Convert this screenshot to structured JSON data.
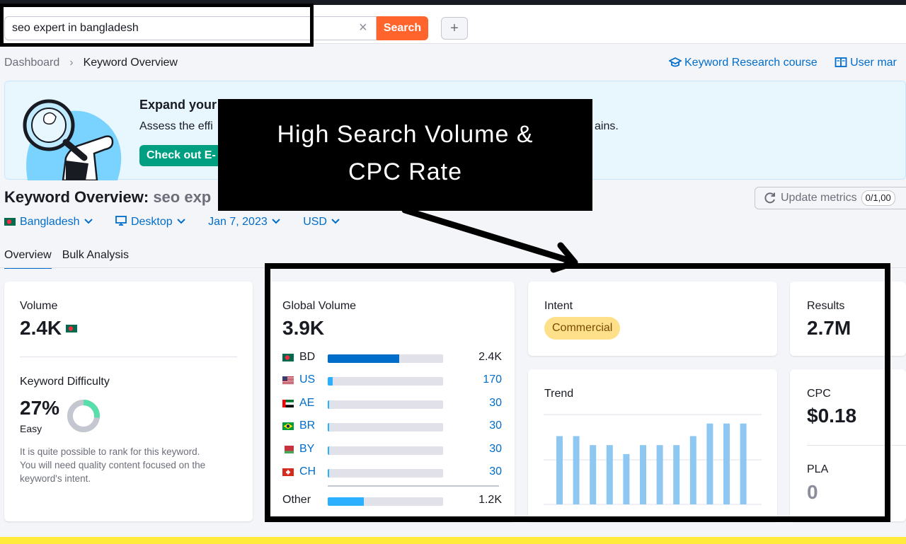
{
  "search": {
    "value": "seo expert in bangladesh",
    "button_label": "Search",
    "add_label": "+",
    "clear_label": "×"
  },
  "breadcrumb": {
    "items": [
      "Dashboard",
      "Keyword Overview"
    ]
  },
  "top_links": {
    "course": "Keyword Research course",
    "manual": "User mar"
  },
  "banner": {
    "title": "Expand your",
    "text": "Assess the effi",
    "text_tail": "ains.",
    "button": "Check out E-"
  },
  "callout": {
    "line1": "High Search Volume &",
    "line2": "CPC Rate"
  },
  "page": {
    "title_prefix": "Keyword Overview:",
    "title_keyword": "seo exp"
  },
  "update": {
    "label": "Update metrics",
    "count": "0/1,00"
  },
  "filters": {
    "country": "Bangladesh",
    "device": "Desktop",
    "date": "Jan 7, 2023",
    "currency": "USD"
  },
  "tabs": [
    "Overview",
    "Bulk Analysis"
  ],
  "volume_card": {
    "label": "Volume",
    "value": "2.4K",
    "kd_label": "Keyword Difficulty",
    "kd_value": "27%",
    "kd_level": "Easy",
    "kd_fraction": 0.27,
    "kd_desc": [
      "It is quite possible to rank for this keyword.",
      "You will need quality content focused on the",
      "keyword's intent."
    ]
  },
  "global_volume": {
    "label": "Global Volume",
    "value": "3.9K",
    "countries": [
      {
        "code": "BD",
        "value": "2.4K",
        "share": 0.62,
        "link": false,
        "color": "#006dca"
      },
      {
        "code": "US",
        "value": "170",
        "share": 0.045,
        "link": true,
        "color": "#2bafff"
      },
      {
        "code": "AE",
        "value": "30",
        "share": 0.012,
        "link": true,
        "color": "#2bafff"
      },
      {
        "code": "BR",
        "value": "30",
        "share": 0.012,
        "link": true,
        "color": "#2bafff"
      },
      {
        "code": "BY",
        "value": "30",
        "share": 0.012,
        "link": true,
        "color": "#2bafff"
      },
      {
        "code": "CH",
        "value": "30",
        "share": 0.012,
        "link": true,
        "color": "#2bafff"
      }
    ],
    "other": {
      "code": "Other",
      "value": "1.2K",
      "share": 0.31
    }
  },
  "intent_card": {
    "label": "Intent",
    "badge": "Commercial"
  },
  "results_card": {
    "label": "Results",
    "value": "2.7M"
  },
  "trend_card": {
    "label": "Trend",
    "bars": [
      0.76,
      0.76,
      0.66,
      0.66,
      0.56,
      0.66,
      0.66,
      0.66,
      0.76,
      0.9,
      0.9,
      0.9
    ]
  },
  "cpc_card": {
    "label": "CPC",
    "value": "$0.18",
    "pla_label": "PLA",
    "pla_value": "0"
  },
  "colors": {
    "accent": "#006dca",
    "search_button": "#ff642d",
    "banner_button": "#009f81",
    "intent_badge": "#ffe08a",
    "trend_bar": "#8ec8f2"
  }
}
